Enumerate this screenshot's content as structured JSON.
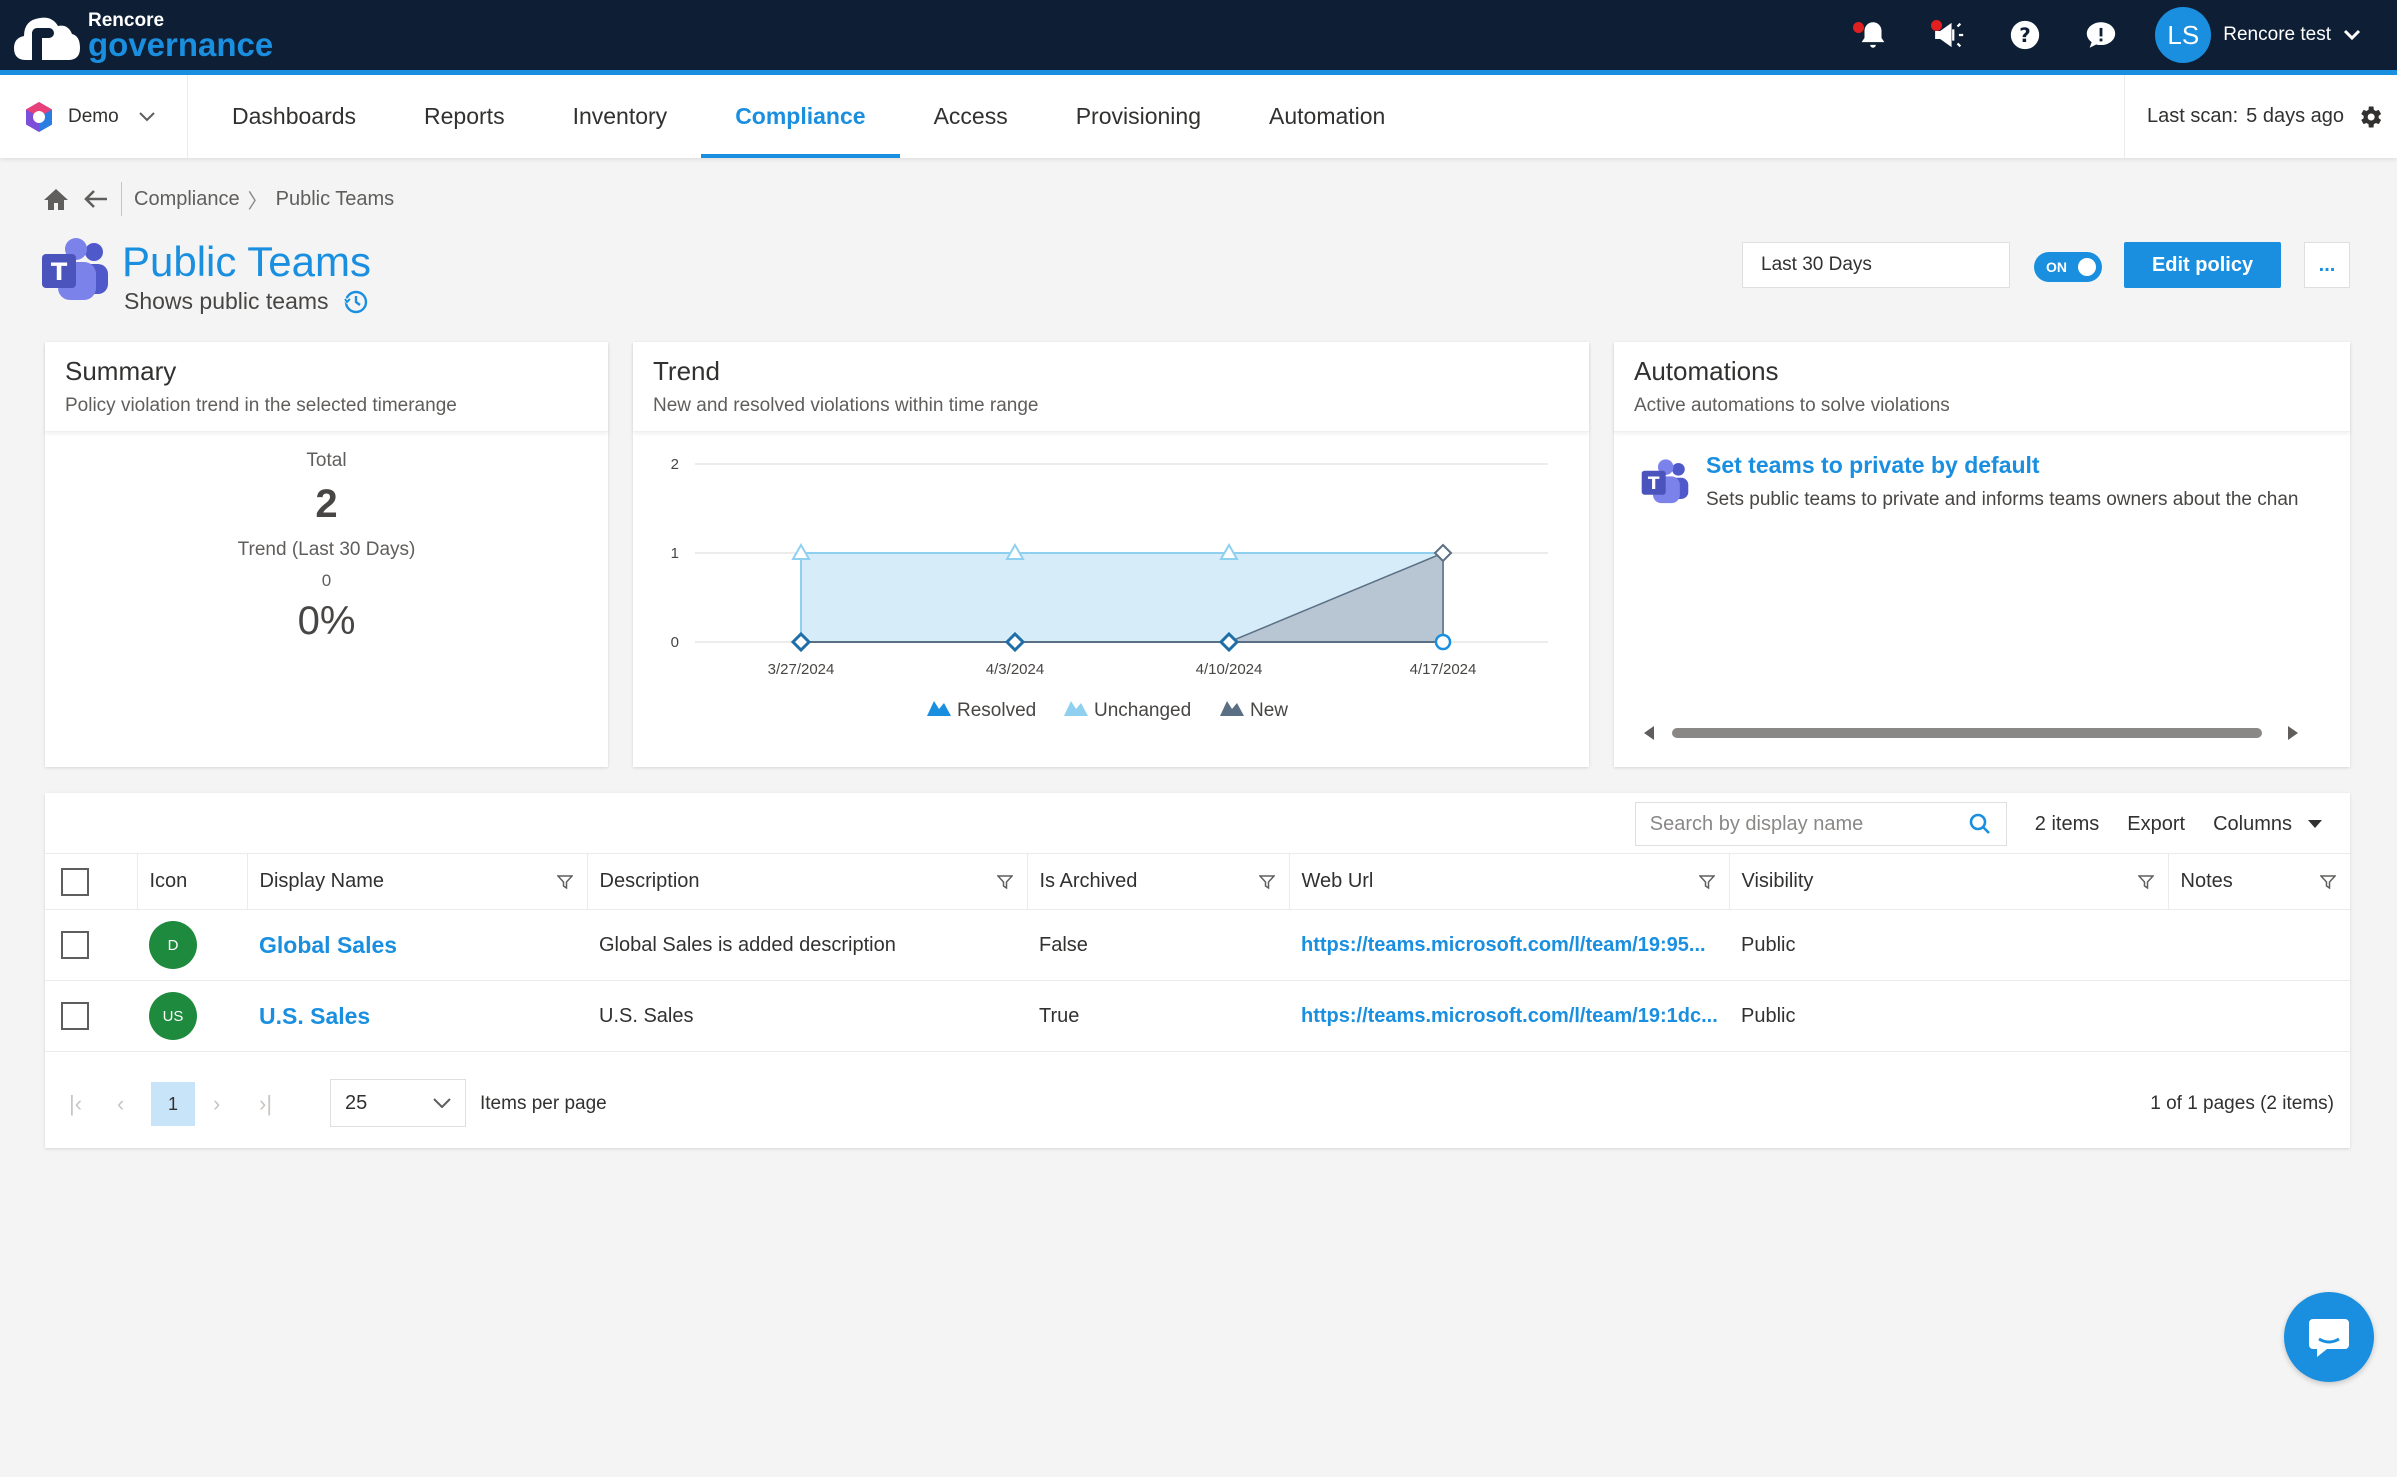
{
  "brand": {
    "line1": "Rencore",
    "line2": "governance"
  },
  "user": {
    "initials": "LS",
    "name": "Rencore test"
  },
  "icons": {
    "bell": "bell-icon",
    "megaphone": "megaphone-icon",
    "help": "help-icon",
    "feedback": "feedback-icon",
    "gear": "gear-icon",
    "home": "home-icon",
    "back": "back-arrow-icon",
    "teams": "teams-icon",
    "history": "history-icon",
    "search": "search-icon",
    "filter": "filter-icon",
    "chat": "chat-icon"
  },
  "tenant": {
    "name": "Demo"
  },
  "nav": {
    "tabs": [
      {
        "label": "Dashboards"
      },
      {
        "label": "Reports"
      },
      {
        "label": "Inventory"
      },
      {
        "label": "Compliance",
        "active": true
      },
      {
        "label": "Access"
      },
      {
        "label": "Provisioning"
      },
      {
        "label": "Automation"
      }
    ],
    "last_scan_label": "Last scan:",
    "last_scan_value": "5 days ago"
  },
  "breadcrumb": {
    "parent": "Compliance",
    "separator": "〉",
    "current": "Public Teams"
  },
  "page": {
    "title": "Public Teams",
    "subtitle": "Shows public teams"
  },
  "controls": {
    "range": "Last 30 Days",
    "toggle": "ON",
    "edit": "Edit policy",
    "more": "..."
  },
  "summary": {
    "title": "Summary",
    "subtitle": "Policy violation trend in the selected timerange",
    "total_label": "Total",
    "total": "2",
    "trend_label": "Trend (Last 30 Days)",
    "trend_value": "0",
    "percent": "0%"
  },
  "trend": {
    "title": "Trend",
    "subtitle": "New and resolved violations within time range"
  },
  "chart_data": {
    "type": "area",
    "title": "",
    "x": [
      "3/27/2024",
      "4/3/2024",
      "4/10/2024",
      "4/17/2024"
    ],
    "ylim": [
      0,
      2
    ],
    "yticks": [
      "0",
      "1",
      "2"
    ],
    "series": [
      {
        "name": "Resolved",
        "values": [
          0,
          0,
          0,
          0
        ],
        "color": "#1a8fe0"
      },
      {
        "name": "Unchanged",
        "values": [
          1,
          1,
          1,
          0
        ],
        "color": "#8fd0f0"
      },
      {
        "name": "New",
        "values": [
          0,
          0,
          0,
          1
        ],
        "color": "#5a6f84"
      }
    ],
    "legend": "bottom",
    "grid": true
  },
  "automations": {
    "title": "Automations",
    "subtitle": "Active automations to solve violations",
    "items": [
      {
        "title": "Set teams to private by default",
        "description": "Sets public teams to private and informs teams owners about the chan"
      }
    ]
  },
  "grid": {
    "search_placeholder": "Search by display name",
    "count": "2 items",
    "export": "Export",
    "columns": "Columns",
    "headers": [
      "Icon",
      "Display Name",
      "Description",
      "Is Archived",
      "Web Url",
      "Visibility",
      "Notes"
    ],
    "rows": [
      {
        "initials": "D",
        "name": "Global Sales",
        "description": "Global Sales is added description",
        "archived": "False",
        "url": "https://teams.microsoft.com/l/team/19:95...",
        "visibility": "Public",
        "notes": ""
      },
      {
        "initials": "US",
        "name": "U.S. Sales",
        "description": "U.S. Sales",
        "archived": "True",
        "url": "https://teams.microsoft.com/l/team/19:1dc...",
        "visibility": "Public",
        "notes": ""
      }
    ]
  },
  "pager": {
    "current": "1",
    "page_size": "25",
    "items_per_page": "Items per page",
    "info": "1 of 1 pages (2 items)"
  }
}
